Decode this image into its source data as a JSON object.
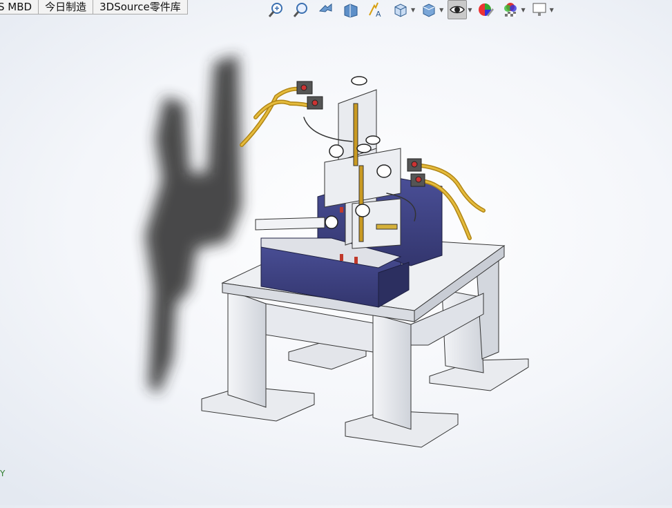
{
  "tabs": [
    {
      "label": "S MBD"
    },
    {
      "label": "今日制造"
    },
    {
      "label": "3DSource零件库"
    }
  ],
  "toolbar": {
    "icons": [
      "zoom-to-fit-icon",
      "zoom-area-icon",
      "previous-view-icon",
      "section-view-icon",
      "dynamic-annotation-icon",
      "view-orientation-icon",
      "display-style-icon",
      "hide-show-items-icon",
      "edit-appearance-icon",
      "apply-scene-icon",
      "view-settings-icon"
    ]
  },
  "viewport": {
    "axis_label": "Y",
    "model": "welding machine assembly",
    "colors": {
      "frame": "#eceef2",
      "blue_panel": "#3d4182",
      "hose": "#c99a22",
      "shadow": "#2a2a2a"
    }
  }
}
